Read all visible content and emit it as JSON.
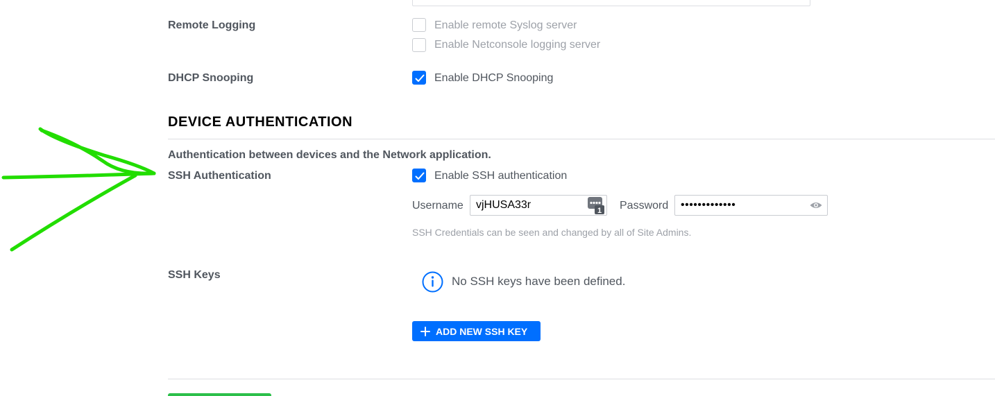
{
  "remote_logging": {
    "label": "Remote Logging",
    "syslog_option": "Enable remote Syslog server",
    "netconsole_option": "Enable Netconsole logging server"
  },
  "dhcp_snooping": {
    "label": "DHCP Snooping",
    "option": "Enable DHCP Snooping",
    "checked": true
  },
  "device_auth": {
    "title": "DEVICE AUTHENTICATION",
    "description": "Authentication between devices and the Network application.",
    "ssh": {
      "label": "SSH Authentication",
      "option": "Enable SSH authentication",
      "checked": true,
      "username_label": "Username",
      "username_value": "vjHUSA33r",
      "password_label": "Password",
      "password_value": "•••••••••••••",
      "hint": "SSH Credentials can be seen and changed by all of Site Admins."
    },
    "ssh_keys": {
      "label": "SSH Keys",
      "empty_message": "No SSH keys have been defined.",
      "add_button": "ADD NEW SSH KEY"
    }
  },
  "colors": {
    "accent": "#006fff",
    "annotation_arrow": "#22dd00",
    "save_button": "#2cbf4a"
  },
  "icons": [
    "checkmark-icon",
    "password-manager-icon",
    "eye-icon",
    "info-icon",
    "plus-icon",
    "arrow-annotation-icon"
  ]
}
